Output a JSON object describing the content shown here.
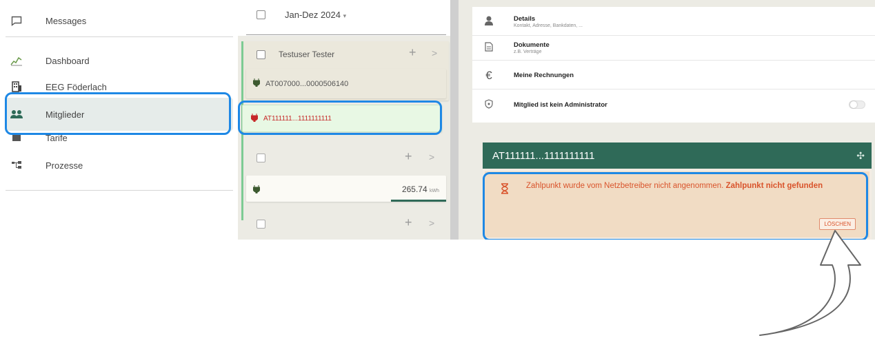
{
  "sidebar": {
    "items": [
      {
        "label": "Messages",
        "icon": "message-square-icon"
      },
      {
        "label": "Dashboard",
        "icon": "chart-icon"
      },
      {
        "label": "EEG Föderlach",
        "icon": "building-icon"
      },
      {
        "label": "Mitglieder",
        "icon": "people-icon"
      },
      {
        "label": "Tarife",
        "icon": "tariff-icon"
      },
      {
        "label": "Prozesse",
        "icon": "process-icon"
      }
    ]
  },
  "middle": {
    "period_label": "Jan-Dez 2024",
    "member_name": "Testuser Tester",
    "meter_1": "AT007000...0000506140",
    "meter_2": "AT111111...1111111111",
    "energy_value": "265.74",
    "energy_unit": "kWh",
    "plus_symbol": "+",
    "chevron_symbol": ">"
  },
  "right": {
    "details_title": "Details",
    "details_sub": "Kontakt, Adresse, Bankdaten, ...",
    "documents_title": "Dokumente",
    "documents_sub": "z.B. Verträge",
    "invoices_title": "Meine Rechnungen",
    "admin_title": "Mitglied ist kein Administrator",
    "meter_header": "AT111111...1111111111",
    "warning_text": "Zahlpunkt wurde vom Netzbetreiber nicht angenommen.",
    "warning_bold": "Zahlpunkt nicht gefunden",
    "delete_label": "LÖSCHEN"
  },
  "colors": {
    "accent": "#2f6a58",
    "highlight": "#1e88e5",
    "warning": "#d9532b",
    "meter_error": "#c62828"
  }
}
